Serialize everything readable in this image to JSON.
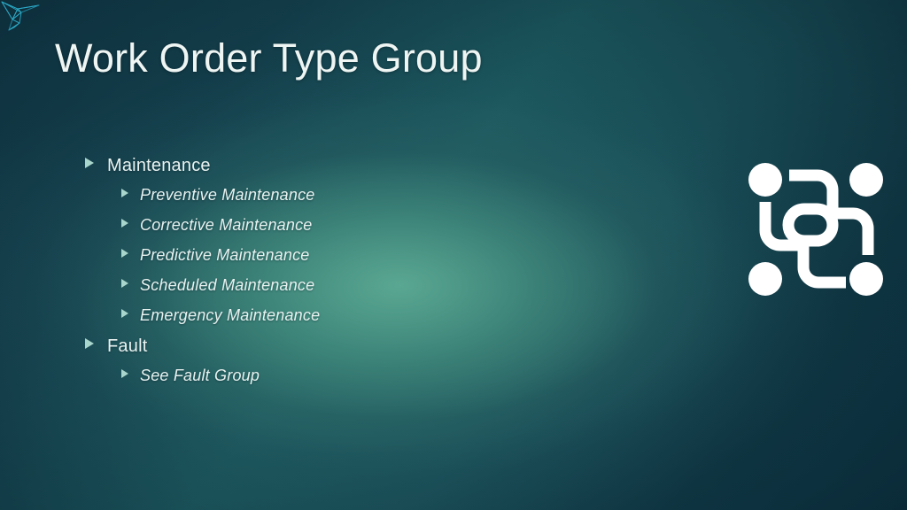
{
  "slide": {
    "title": "Work Order Type Group",
    "background": {
      "edge_color": "#123846",
      "center_glow_color": "#3a7d70",
      "corner_dark_color": "#0e3441"
    },
    "logo": {
      "name": "origami-bird-logo",
      "color": "#29a8c4"
    },
    "decor_icon": {
      "name": "network-nodes-icon",
      "color": "#ffffff"
    },
    "bullet_marker_color": "#a9d6cc",
    "text_color": "#eaf3f1",
    "bullets": [
      {
        "level": 1,
        "text": "Maintenance"
      },
      {
        "level": 2,
        "text": "Preventive Maintenance"
      },
      {
        "level": 2,
        "text": "Corrective Maintenance"
      },
      {
        "level": 2,
        "text": "Predictive Maintenance"
      },
      {
        "level": 2,
        "text": "Scheduled Maintenance"
      },
      {
        "level": 2,
        "text": "Emergency Maintenance"
      },
      {
        "level": 1,
        "text": "Fault"
      },
      {
        "level": 2,
        "text": "See Fault Group"
      }
    ]
  }
}
